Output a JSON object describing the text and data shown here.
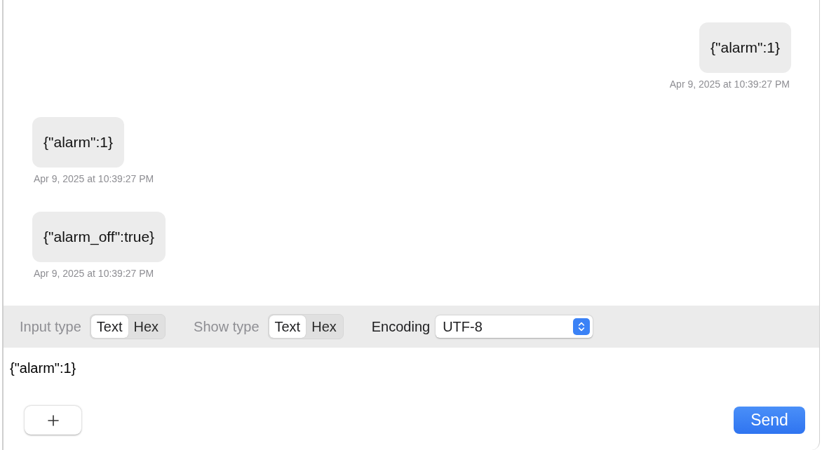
{
  "messages": [
    {
      "kind": "sent",
      "text": "{\"alarm\":1}",
      "time": "Apr 9, 2025 at 10:39:27 PM"
    },
    {
      "kind": "received",
      "text": "{\"alarm\":1}",
      "time": "Apr 9, 2025 at 10:39:27 PM"
    },
    {
      "kind": "received",
      "text": "{\"alarm_off\":true}",
      "time": "Apr 9, 2025 at 10:39:27 PM"
    }
  ],
  "toolbar": {
    "input_type": {
      "label": "Input type",
      "options": [
        {
          "label": "Text",
          "selected": true
        },
        {
          "label": "Hex",
          "selected": false
        }
      ]
    },
    "show_type": {
      "label": "Show type",
      "options": [
        {
          "label": "Text",
          "selected": true
        },
        {
          "label": "Hex",
          "selected": false
        }
      ]
    },
    "encoding": {
      "label": "Encoding",
      "value": "UTF-8"
    }
  },
  "composer": {
    "value": "{\"alarm\":1}"
  },
  "send_button": "Send"
}
